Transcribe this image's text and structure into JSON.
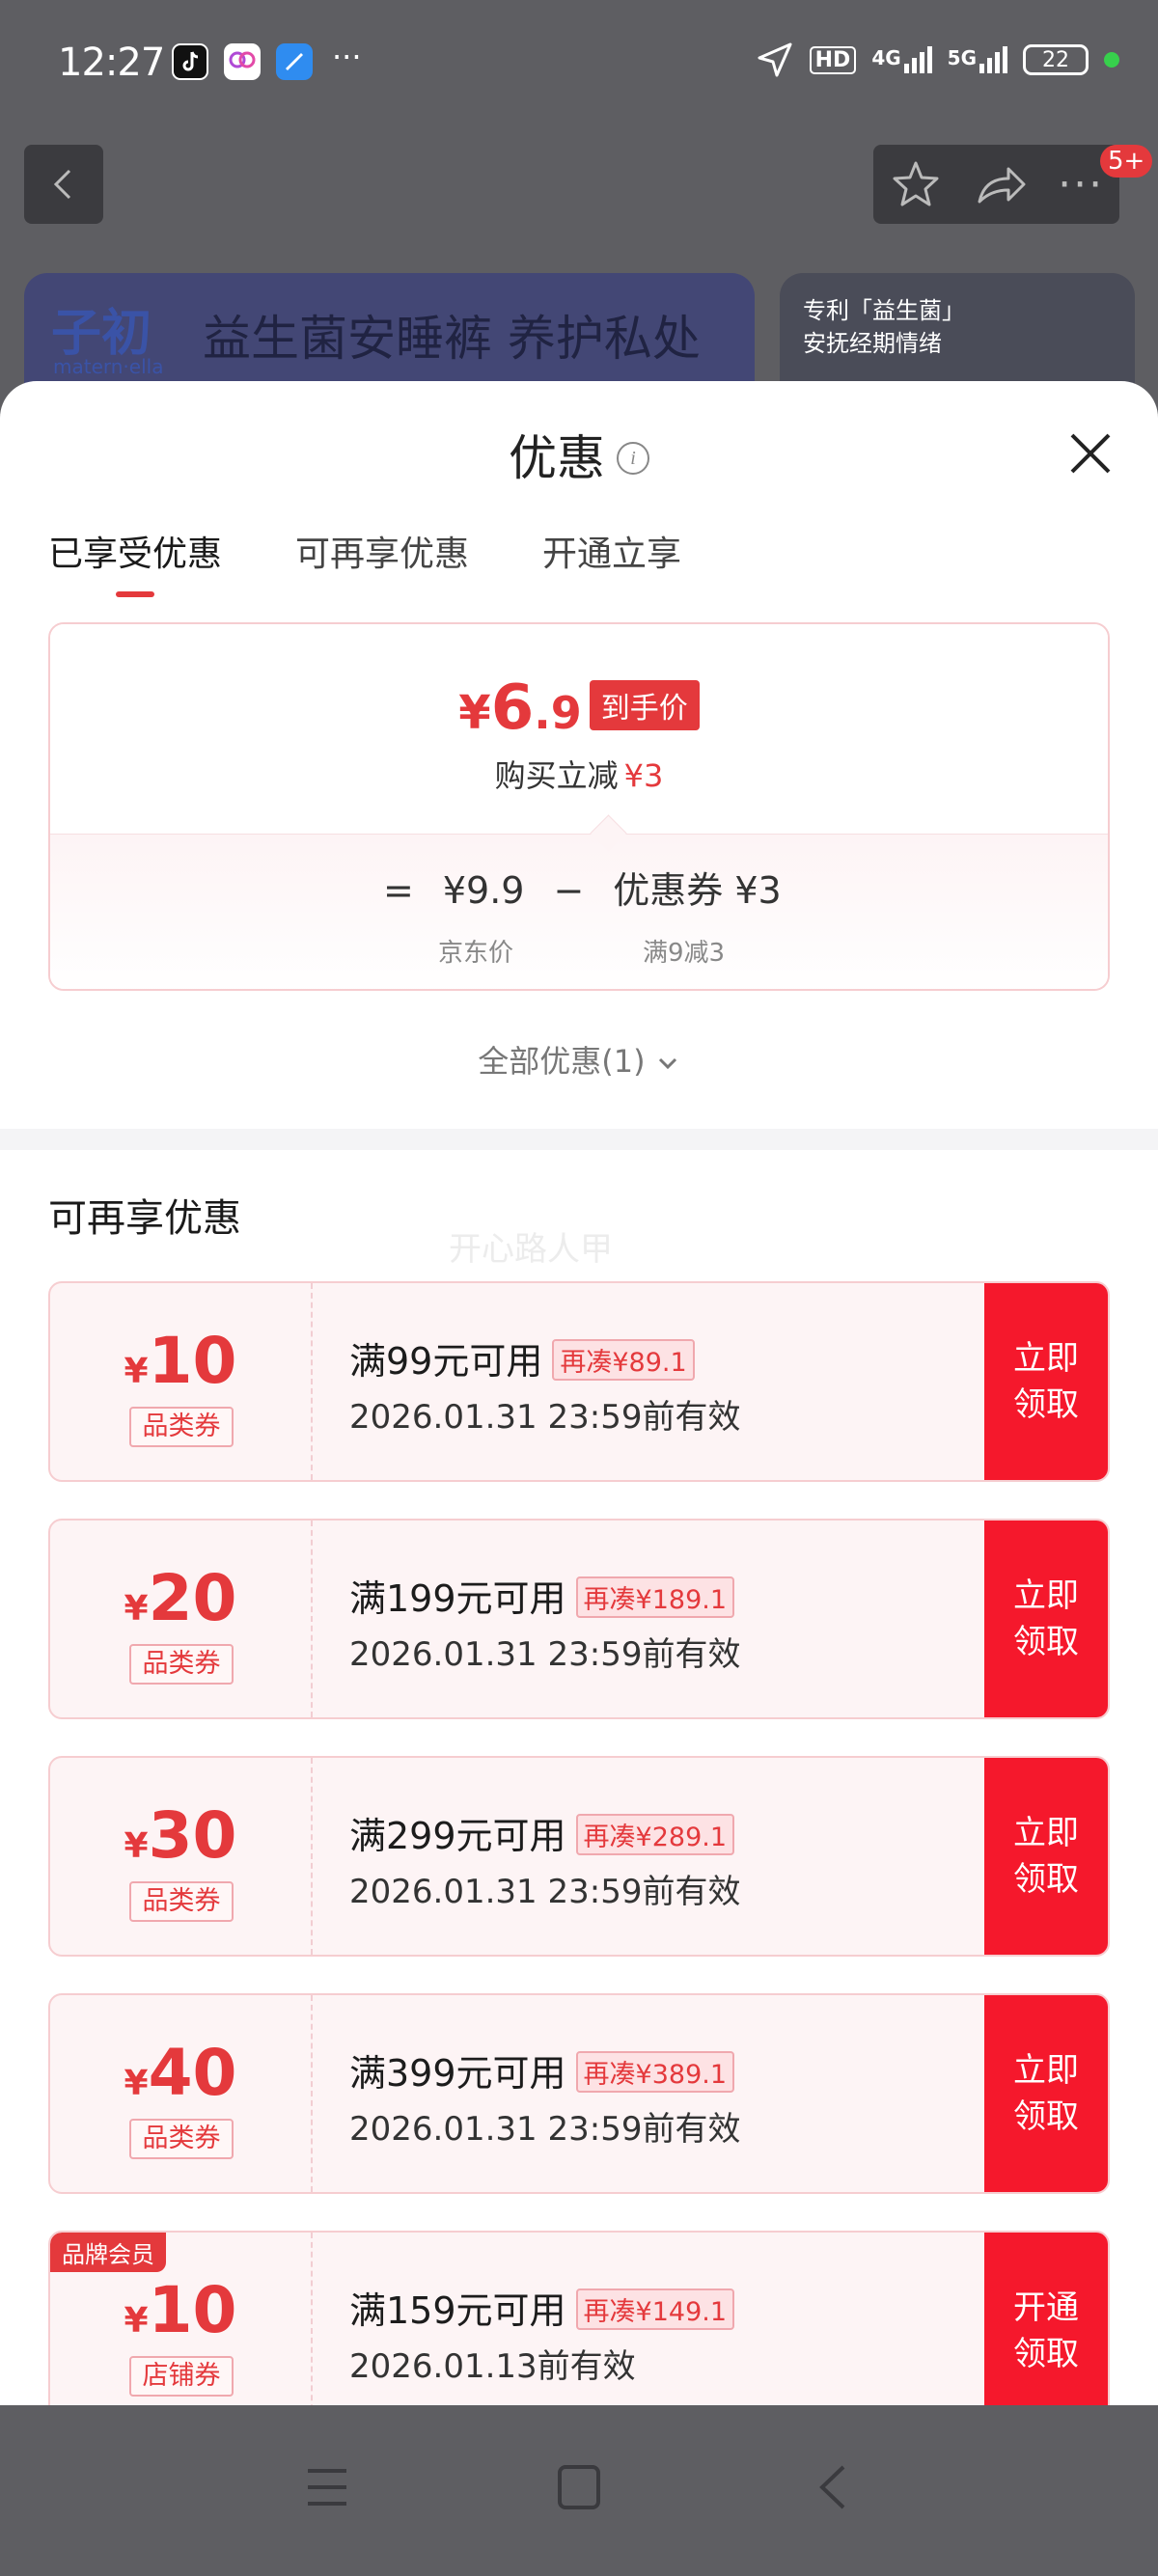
{
  "status_bar": {
    "time": "12:27",
    "network_hd": "HD",
    "network_4g": "4G",
    "network_5g": "5G",
    "battery": "22"
  },
  "top_actions": {
    "badge": "5+"
  },
  "banner": {
    "logo": "子初",
    "logo_sub": "matern·ella",
    "title": "益生菌安睡裤 养护私处",
    "side_line1": "专利「益生菌」",
    "side_line2": "安抚经期情绪"
  },
  "sheet": {
    "title": "优惠",
    "info_icon": "i",
    "tabs": [
      {
        "label": "已享受优惠"
      },
      {
        "label": "可再享优惠"
      },
      {
        "label": "开通立享"
      }
    ],
    "summary": {
      "price_symbol": "¥",
      "price_int": "6",
      "price_dec": ".9",
      "price_tag": "到手价",
      "reduce_label": "购买立减",
      "reduce_amount": "¥3",
      "eq": "=",
      "jd_price": "¥9.9",
      "minus": "−",
      "coupon_label": "优惠券 ¥3",
      "jd_price_caption": "京东价",
      "coupon_caption": "满9减3"
    },
    "all_discounts": "全部优惠(1)",
    "section_title": "可再享优惠",
    "watermark": "开心路人甲",
    "coupons": [
      {
        "symbol": "¥",
        "amount": "10",
        "type": "品类券",
        "condition": "满99元可用",
        "gap": "再凑¥89.1",
        "date": "2026.01.31 23:59前有效",
        "btn1": "立即",
        "btn2": "领取"
      },
      {
        "symbol": "¥",
        "amount": "20",
        "type": "品类券",
        "condition": "满199元可用",
        "gap": "再凑¥189.1",
        "date": "2026.01.31 23:59前有效",
        "btn1": "立即",
        "btn2": "领取"
      },
      {
        "symbol": "¥",
        "amount": "30",
        "type": "品类券",
        "condition": "满299元可用",
        "gap": "再凑¥289.1",
        "date": "2026.01.31 23:59前有效",
        "btn1": "立即",
        "btn2": "领取"
      },
      {
        "symbol": "¥",
        "amount": "40",
        "type": "品类券",
        "condition": "满399元可用",
        "gap": "再凑¥389.1",
        "date": "2026.01.31 23:59前有效",
        "btn1": "立即",
        "btn2": "领取"
      },
      {
        "badge": "品牌会员",
        "symbol": "¥",
        "amount": "10",
        "type": "店铺券",
        "condition": "满159元可用",
        "gap": "再凑¥149.1",
        "date": "2026.01.13前有效",
        "btn1": "开通",
        "btn2": "领取"
      }
    ]
  },
  "colors": {
    "accent": "#e4393c",
    "button_red": "#f5182c",
    "coupon_bg": "#fdf4f5"
  }
}
